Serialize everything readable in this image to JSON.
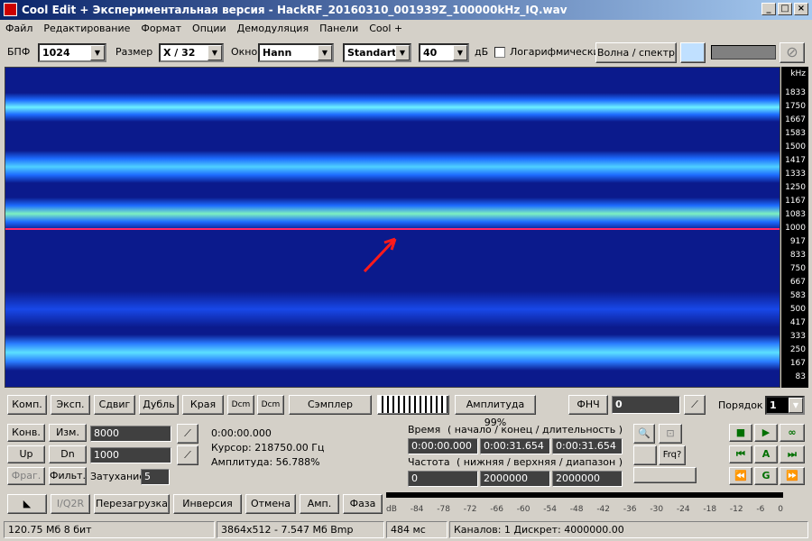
{
  "window": {
    "title": "Cool Edit + Экспериментальная версия - HackRF_20160310_001939Z_100000kHz_IQ.wav"
  },
  "menu": [
    "Файл",
    "Редактирование",
    "Формат",
    "Опции",
    "Демодуляция",
    "Панели",
    "Cool +"
  ],
  "toolbar": {
    "fft_label": "БПФ",
    "fft_value": "1024",
    "size_label": "Размер",
    "size_value": "X / 32",
    "window_label": "Окно",
    "window_value": "Hann",
    "mode_value": "Standart",
    "db_value": "40",
    "db_label": "дБ",
    "log_label": "Логарифмически",
    "wave_button": "Волна / спектр"
  },
  "axis": {
    "unit": "kHz",
    "ticks": [
      "1833",
      "1750",
      "1667",
      "1583",
      "1500",
      "1417",
      "1333",
      "1250",
      "1167",
      "1083",
      "1000",
      "917",
      "833",
      "750",
      "667",
      "583",
      "500",
      "417",
      "333",
      "250",
      "167",
      "83"
    ]
  },
  "buttons_row1": {
    "komp": "Комп.",
    "eksp": "Эксп.",
    "sdvig": "Сдвиг",
    "dubl": "Дубль",
    "kraya": "Края",
    "dcm_up": "Dcm",
    "dcm_down": "Dcm",
    "sampler": "Сэмплер",
    "amplitude": "Амплитуда 99%",
    "fnch": "ФНЧ",
    "fnch_value": "0",
    "order_label": "Порядок",
    "order_value": "1"
  },
  "left_panel": {
    "konv": "Конв.",
    "izm": "Изм.",
    "up": "Up",
    "dn": "Dn",
    "frag": "Фраг.",
    "filt": "Фильт.",
    "value1": "8000",
    "value2": "1000",
    "attenuation_label": "Затухание",
    "attenuation_value": "5"
  },
  "cursor_info": {
    "time": "0:00:00.000",
    "cursor": "Курсор: 218750.00 Гц",
    "amplitude": "Амплитуда: 56.788%"
  },
  "time_panel": {
    "time_label": "Время",
    "time_hint": "( начало / конец / длительность )",
    "t_start": "0:00:00.000",
    "t_end": "0:00:31.654",
    "t_dur": "0:00:31.654",
    "freq_label": "Частота",
    "freq_hint": "( нижняя / верхняя / диапазон )",
    "f_low": "0",
    "f_high": "2000000",
    "f_range": "2000000",
    "frq_button": "Frq?"
  },
  "transport": {
    "a": "A",
    "g": "G"
  },
  "bottom_buttons": {
    "iq2r": "I/Q2R",
    "reload": "Перезагрузка",
    "invert": "Инверсия",
    "cancel": "Отмена",
    "amp": "Амп.",
    "phase": "Фаза"
  },
  "meter": {
    "ticks": [
      "dB",
      "-84",
      "-78",
      "-72",
      "-66",
      "-60",
      "-54",
      "-48",
      "-42",
      "-36",
      "-30",
      "-24",
      "-18",
      "-12",
      "-6",
      "0"
    ]
  },
  "status": {
    "s1": "120.75 Мб 8 бит",
    "s2": "3864x512 - 7.547 Мб Bmp",
    "s3": "484 мс",
    "s4": "Каналов: 1  Дискрет: 4000000.00"
  }
}
